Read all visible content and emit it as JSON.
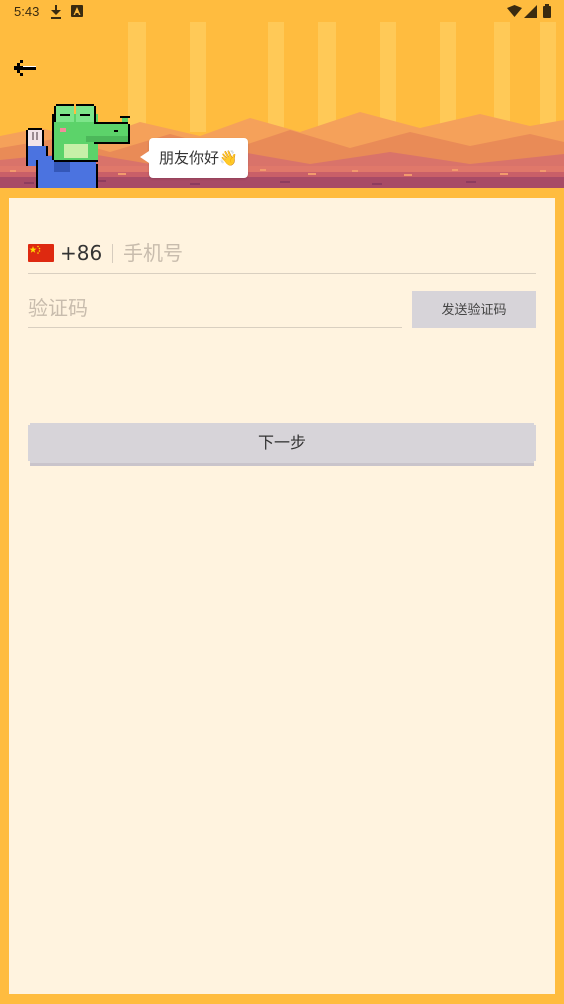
{
  "status_bar": {
    "time": "5:43",
    "icons": [
      "download-icon",
      "a-icon",
      "wifi-icon",
      "signal-icon",
      "battery-icon"
    ]
  },
  "header": {
    "back_icon": "arrow-left-icon",
    "greeting": "朋友你好👋"
  },
  "login_form": {
    "country_flag": "china-flag-icon",
    "country_code": "+86",
    "phone_placeholder": "手机号",
    "phone_value": "",
    "code_placeholder": "验证码",
    "code_value": "",
    "send_code_label": "发送验证码",
    "next_label": "下一步"
  },
  "colors": {
    "header_background": "#FFBC3F",
    "card_background": "#FFF3DF",
    "button_disabled": "#D7D4D9",
    "placeholder_text": "#C8BCAD",
    "flag_red": "#DE2910",
    "flag_yellow": "#FFDE00"
  }
}
